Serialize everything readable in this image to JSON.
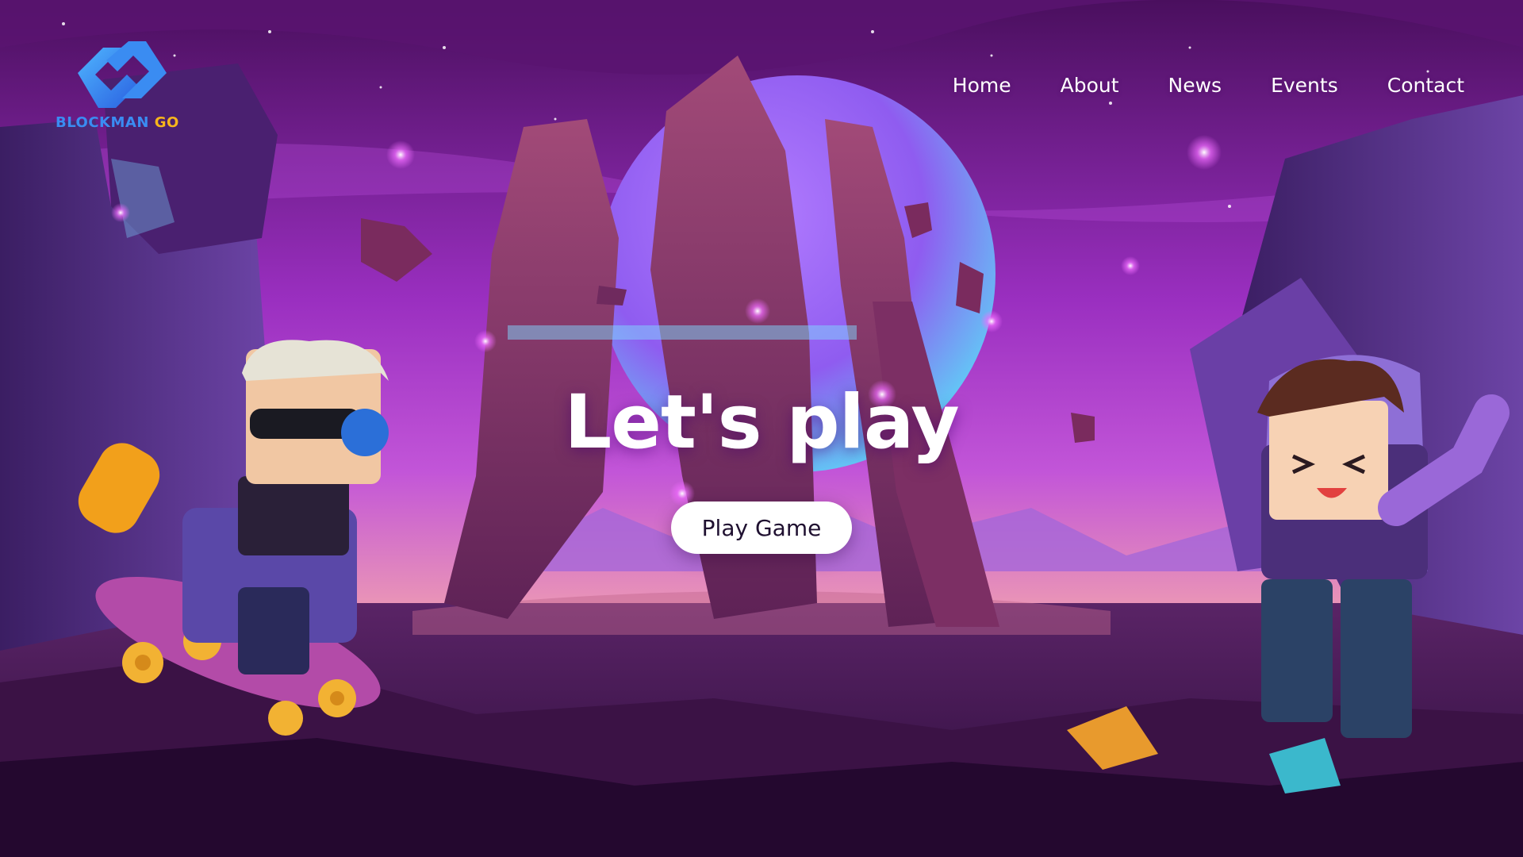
{
  "brand": {
    "name_main": "BLOCKMAN",
    "name_suffix": "GO",
    "logo_icon": "blockman-go-logo-icon",
    "colors": {
      "blue": "#3a8cf2",
      "gold": "#f6b51c"
    }
  },
  "nav": {
    "items": [
      {
        "label": "Home"
      },
      {
        "label": "About"
      },
      {
        "label": "News"
      },
      {
        "label": "Events"
      },
      {
        "label": "Contact"
      }
    ]
  },
  "hero": {
    "headline": "Let's play",
    "cta_label": "Play Game",
    "background": "purple-alien-landscape-illustration",
    "colors": {
      "sky_top": "#4a0f5e",
      "sky_mid": "#a63ed0",
      "horizon": "#f0a7a0",
      "moon": "#8f5cf0"
    }
  }
}
